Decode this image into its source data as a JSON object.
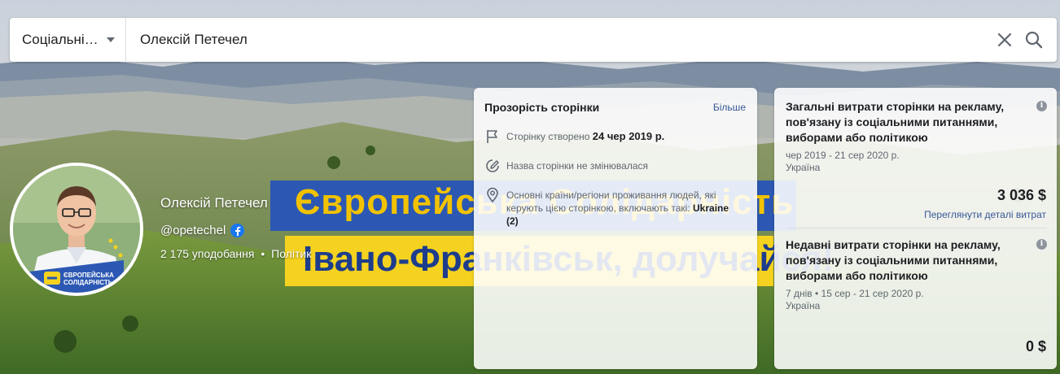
{
  "search": {
    "category": "Соціальні…",
    "query": "Олексій Петечел"
  },
  "cover": {
    "banner_line1": "Європейська Солідарність",
    "banner_line2": "Івано-Франківськ, долучайся!"
  },
  "profile": {
    "name": "Олексій Петечел",
    "handle": "@opetechel",
    "likes": "2 175 уподобання",
    "separator": "•",
    "category": "Політик",
    "avatar_logo_line1": "ЄВРОПЕЙСЬКА",
    "avatar_logo_line2": "СОЛІДАРНІСТЬ"
  },
  "transparency": {
    "title": "Прозорість сторінки",
    "more_label": "Більше",
    "created_label": "Сторінку створено",
    "created_date": "24 чер 2019 р.",
    "name_unchanged": "Назва сторінки не змінювалася",
    "countries_label": "Основні країни/регіони проживання людей, які керують цією сторінкою, включають такі:",
    "countries_value": "Ukraine (2)"
  },
  "spend_total": {
    "title": "Загальні витрати сторінки на рекламу, пов'язану із соціальними питаннями, виборами або політикою",
    "date_range": "чер 2019 - 21 сер 2020 р.",
    "country": "Україна",
    "amount": "3 036 $",
    "details_link": "Переглянути деталі витрат"
  },
  "spend_recent": {
    "title": "Недавні витрати сторінки на рекламу, пов'язану із соціальними питаннями, виборами або політикою",
    "date_range": "7 днів • 15 сер - 21 сер 2020 р.",
    "country": "Україна",
    "amount": "0 $"
  },
  "colors": {
    "link": "#385898",
    "facebook_blue": "#1877f2",
    "party_blue": "#2c58b3",
    "party_yellow": "#f4d21f"
  }
}
